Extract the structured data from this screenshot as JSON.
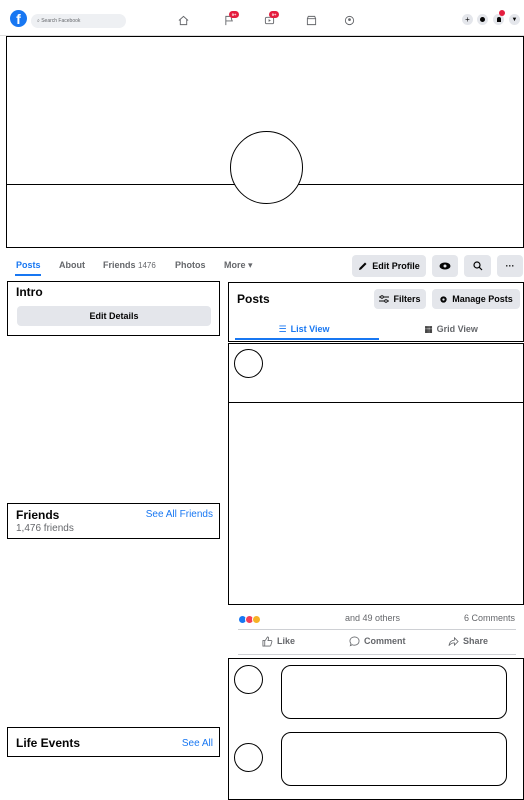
{
  "topbar": {
    "logo": "f",
    "search_placeholder": "Search Facebook",
    "flag_badge": "9+",
    "video_badge": "9+"
  },
  "profile_tabs": {
    "posts": "Posts",
    "about": "About",
    "friends_label": "Friends",
    "friends_count": "1476",
    "photos": "Photos",
    "more": "More ▾"
  },
  "profile_actions": {
    "edit_profile": "Edit Profile",
    "more_dots": "···"
  },
  "intro": {
    "title": "Intro",
    "edit_details": "Edit Details"
  },
  "friends_card": {
    "title": "Friends",
    "see_all": "See All Friends",
    "count_text": "1,476 friends"
  },
  "life_events": {
    "title": "Life Events",
    "see_all": "See All"
  },
  "posts_panel": {
    "title": "Posts",
    "filters": "Filters",
    "manage_posts": "Manage Posts",
    "list_view": "List View",
    "grid_view": "Grid View"
  },
  "post": {
    "reactions_text": "and 49 others",
    "comments_text": "6 Comments",
    "like": "Like",
    "comment": "Comment",
    "share": "Share"
  },
  "colors": {
    "accent": "#1877f2",
    "badge": "#e41e3f",
    "grey_button": "#e4e6eb"
  }
}
